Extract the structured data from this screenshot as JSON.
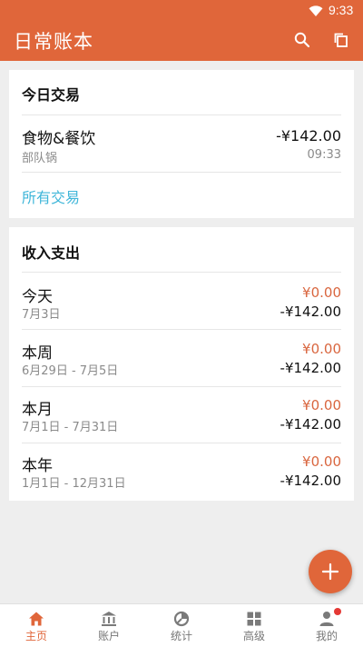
{
  "status": {
    "time": "9:33"
  },
  "appbar": {
    "title": "日常账本",
    "icons": [
      "search-icon",
      "copy-icon"
    ]
  },
  "today": {
    "title": "今日交易",
    "transaction": {
      "category": "食物&餐饮",
      "note": "部队锅",
      "amount": "-¥142.00",
      "time": "09:33"
    },
    "all_link": "所有交易"
  },
  "summary": {
    "title": "收入支出",
    "rows": [
      {
        "name": "今天",
        "range": "7月3日",
        "income": "¥0.00",
        "expense": "-¥142.00"
      },
      {
        "name": "本周",
        "range": "6月29日 - 7月5日",
        "income": "¥0.00",
        "expense": "-¥142.00"
      },
      {
        "name": "本月",
        "range": "7月1日 - 7月31日",
        "income": "¥0.00",
        "expense": "-¥142.00"
      },
      {
        "name": "本年",
        "range": "1月1日 - 12月31日",
        "income": "¥0.00",
        "expense": "-¥142.00"
      }
    ]
  },
  "fab": {
    "icon": "plus-icon"
  },
  "nav": {
    "items": [
      {
        "label": "主页",
        "icon": "home-icon",
        "active": true
      },
      {
        "label": "账户",
        "icon": "bank-icon"
      },
      {
        "label": "统计",
        "icon": "stats-icon"
      },
      {
        "label": "高级",
        "icon": "grid-icon"
      },
      {
        "label": "我的",
        "icon": "person-icon"
      }
    ]
  },
  "colors": {
    "accent": "#e0663a",
    "link": "#3fb6d9",
    "income": "#d9663f",
    "badge": "#e53935"
  }
}
